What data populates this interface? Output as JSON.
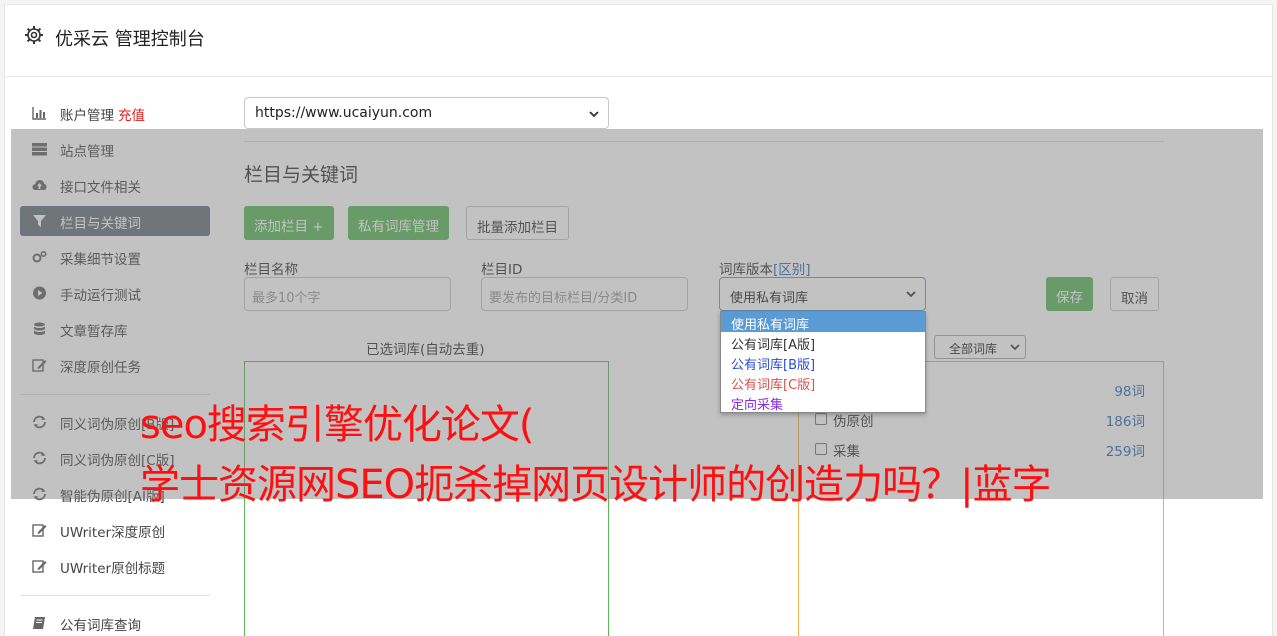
{
  "app": {
    "title": "优采云 管理控制台"
  },
  "sidebar": {
    "items": [
      {
        "label": "账户管理",
        "extra": "充值",
        "icon": "bar-chart-icon"
      },
      {
        "label": "站点管理",
        "icon": "server-icon"
      },
      {
        "label": "接口文件相关",
        "icon": "cloud-upload-icon"
      },
      {
        "label": "栏目与关键词",
        "icon": "filter-icon",
        "active": true
      },
      {
        "label": "采集细节设置",
        "icon": "gears-icon"
      },
      {
        "label": "手动运行测试",
        "icon": "play-circle-icon"
      },
      {
        "label": "文章暂存库",
        "icon": "database-icon"
      },
      {
        "label": "深度原创任务",
        "icon": "edit-icon"
      },
      {
        "label": "同义词伪原创[B版]",
        "icon": "refresh-icon"
      },
      {
        "label": "同义词伪原创[C版]",
        "icon": "refresh-icon"
      },
      {
        "label": "智能伪原创[AI版]",
        "icon": "refresh-icon"
      },
      {
        "label": "UWriter深度原创",
        "icon": "edit-icon"
      },
      {
        "label": "UWriter原创标题",
        "icon": "edit-icon"
      },
      {
        "label": "公有词库查询",
        "icon": "book-icon"
      }
    ]
  },
  "site": {
    "selected": "https://www.ucaiyun.com"
  },
  "section": {
    "title": "栏目与关键词"
  },
  "buttons": {
    "add_column": "添加栏目 +",
    "private_lib": "私有词库管理",
    "batch_add": "批量添加栏目",
    "save": "保存",
    "cancel": "取消"
  },
  "form": {
    "column_name_label": "栏目名称",
    "column_name_placeholder": "最多10个字",
    "column_id_label": "栏目ID",
    "column_id_placeholder": "要发布的目标栏目/分类ID",
    "lib_version_label": "词库版本",
    "lib_version_link": "[区别]",
    "lib_version_selected": "使用私有词库",
    "lib_version_options": [
      {
        "label": "使用私有词库",
        "color": "#ffffff"
      },
      {
        "label": "公有词库[A版]",
        "color": "#333333"
      },
      {
        "label": "公有词库[B版]",
        "color": "#2a4fd6"
      },
      {
        "label": "公有词库[C版]",
        "color": "#d9534f"
      },
      {
        "label": "定向采集",
        "color": "#8a2be2"
      }
    ]
  },
  "selected_libs": {
    "label": "已选词库(自动去重)"
  },
  "all_libs": {
    "filter_selected": "全部词库",
    "rows": [
      {
        "name": "",
        "count": "98词"
      },
      {
        "name": "伪原创",
        "count": "186词"
      },
      {
        "name": "采集",
        "count": "259词"
      }
    ]
  },
  "headline": {
    "line1": "seo搜索引擎优化论文(",
    "line2": "学士资源网SEO扼杀掉网页设计师的创造力吗？|蓝字"
  }
}
